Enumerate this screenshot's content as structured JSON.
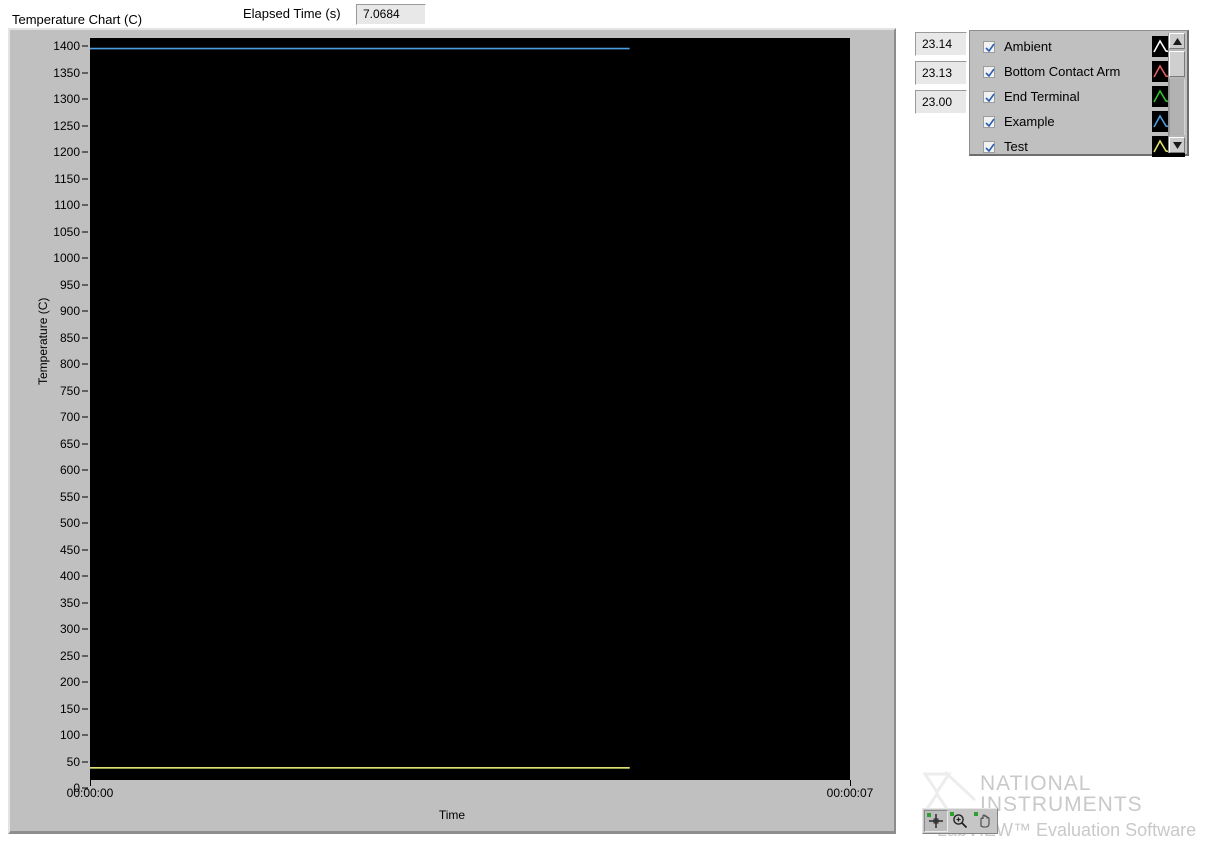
{
  "header": {
    "chart_title": "Temperature Chart (C)",
    "elapsed_label": "Elapsed Time (s)",
    "elapsed_value": "7.0684"
  },
  "indicators": [
    {
      "name": "indicator-1",
      "value": "23.14"
    },
    {
      "name": "indicator-2",
      "value": "23.13"
    },
    {
      "name": "indicator-3",
      "value": "23.00"
    }
  ],
  "legend": {
    "scrollbar": {
      "up_icon": "triangle-up-icon",
      "down_icon": "triangle-down-icon"
    },
    "items": [
      {
        "label": "Ambient",
        "checked": true,
        "color": "#ffffff"
      },
      {
        "label": "Bottom Contact Arm",
        "checked": true,
        "color": "#e06060"
      },
      {
        "label": "End Terminal",
        "checked": true,
        "color": "#30c030"
      },
      {
        "label": "Example",
        "checked": true,
        "color": "#4d9de0"
      },
      {
        "label": "Test",
        "checked": true,
        "color": "#e0e070"
      }
    ]
  },
  "palette": {
    "tools": [
      {
        "name": "cursor-crosshair-tool",
        "label": "Cursor",
        "selected": true
      },
      {
        "name": "zoom-magnifier-tool",
        "label": "Zoom",
        "selected": false
      },
      {
        "name": "pan-hand-tool",
        "label": "Pan",
        "selected": false
      }
    ]
  },
  "watermark": {
    "line1": "NATIONAL",
    "line2": "INSTRUMENTS",
    "line3": "LabVIEW™ Evaluation Software"
  },
  "chart_data": {
    "type": "line",
    "title": "Temperature Chart (C)",
    "xlabel": "Time",
    "ylabel": "Temperature (C)",
    "ylim": [
      0,
      1400
    ],
    "ytick_step": 50,
    "yticks": [
      1400,
      1350,
      1300,
      1250,
      1200,
      1150,
      1100,
      1050,
      1000,
      950,
      900,
      850,
      800,
      750,
      700,
      650,
      600,
      550,
      500,
      450,
      400,
      350,
      300,
      250,
      200,
      150,
      100,
      50,
      0
    ],
    "xticks": [
      "00:00:00",
      "00:00:07"
    ],
    "xlim_labels": [
      "00:00:00",
      "00:00:07"
    ],
    "grid": false,
    "legend_position": "right",
    "plot_background": "#000000",
    "data_extent_fraction": 0.71,
    "series": [
      {
        "name": "Ambient",
        "color": "#ffffff",
        "visible": true,
        "values": [
          23.14,
          23.14
        ],
        "x": [
          0,
          4.97
        ]
      },
      {
        "name": "Bottom Contact Arm",
        "color": "#e06060",
        "visible": true,
        "values": [
          23.13,
          23.13
        ],
        "x": [
          0,
          4.97
        ]
      },
      {
        "name": "End Terminal",
        "color": "#30c030",
        "visible": true,
        "values": [
          23.0,
          23.0
        ],
        "x": [
          0,
          4.97
        ]
      },
      {
        "name": "Example",
        "color": "#4d9de0",
        "visible": true,
        "values": [
          1380,
          1380
        ],
        "x": [
          0,
          4.97
        ]
      },
      {
        "name": "Test",
        "color": "#e0e070",
        "visible": true,
        "values": [
          23.05,
          23.05
        ],
        "x": [
          0,
          4.97
        ]
      }
    ]
  }
}
